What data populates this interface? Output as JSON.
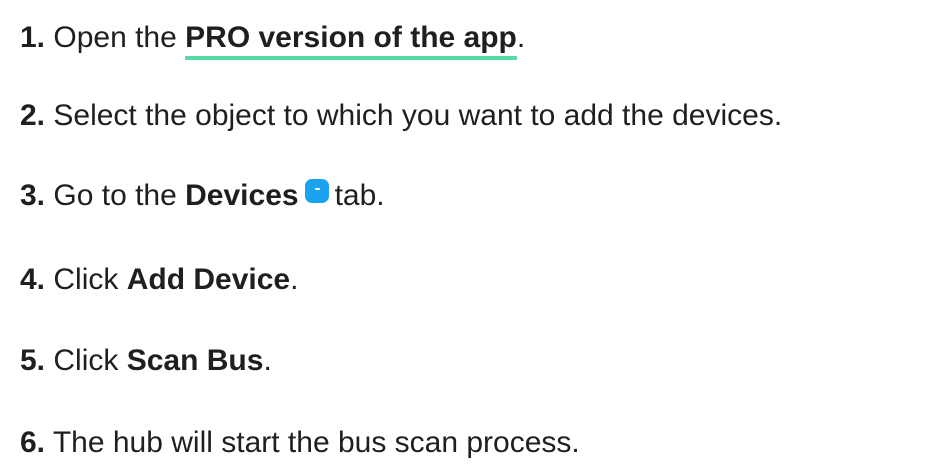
{
  "steps": [
    {
      "number": "1.",
      "text_before": "Open the",
      "link": "PRO version of the app",
      "text_after": "."
    },
    {
      "number": "2.",
      "text": "Select the object to which you want to add the devices."
    },
    {
      "number": "3.",
      "text_before": "Go to the",
      "bold": "Devices",
      "icon": "devices-tab-icon",
      "text_after": "tab."
    },
    {
      "number": "4.",
      "text_before": "Click",
      "bold": "Add Device",
      "text_after": "."
    },
    {
      "number": "5.",
      "text_before": "Click",
      "bold": "Scan Bus",
      "text_after": "."
    },
    {
      "number": "6.",
      "text": "The hub will start the bus scan process."
    }
  ],
  "colors": {
    "text": "#1f1f1f",
    "link_underline": "#57d9a8",
    "icon_background": "#1ba3f2"
  }
}
